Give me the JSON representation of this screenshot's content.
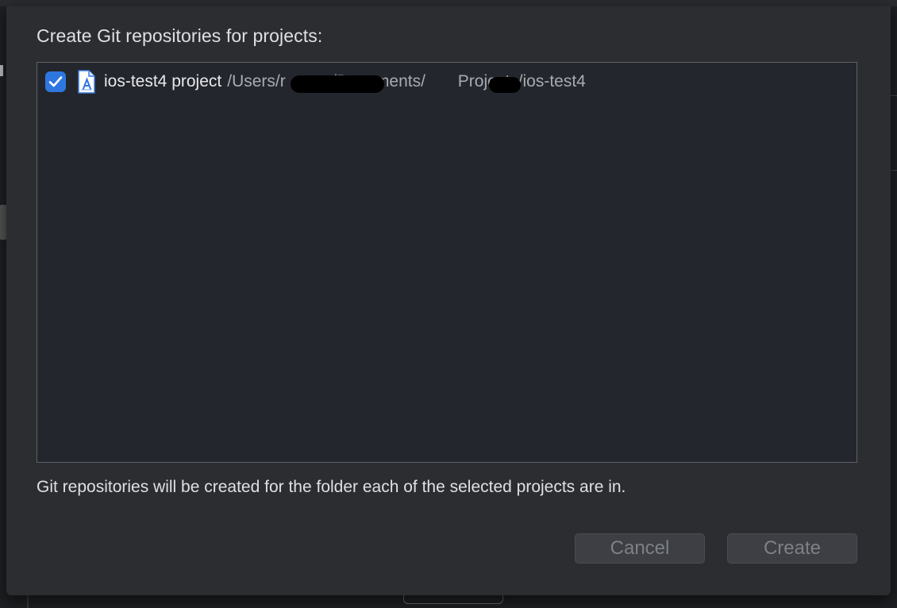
{
  "dialog": {
    "heading": "Create Git repositories for projects:",
    "projects": [
      {
        "checked": true,
        "icon": "xcode-project-file-icon",
        "name": "ios-test4 project",
        "path": "/Users/r          /Documents/       Projects/ios-test4"
      }
    ],
    "info_text": "Git repositories will be created for the folder each of the selected projects are in.",
    "cancel_label": "Cancel",
    "create_label": "Create"
  },
  "colors": {
    "accent": "#2f77e0",
    "sheet_background": "#2b2d31",
    "list_background": "#24262d"
  }
}
